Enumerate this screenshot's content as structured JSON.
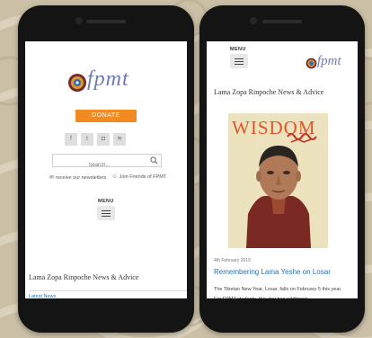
{
  "left_phone": {
    "logo_text": "fpmt",
    "donate_label": "DONATE",
    "social_icons": [
      "facebook-icon",
      "twitter-icon",
      "instagram-icon",
      "rss-icon"
    ],
    "social_glyphs": [
      "f",
      "t",
      "◘",
      "≋"
    ],
    "search_placeholder": "Search...",
    "newsletter_link": "receive our newsletters",
    "friends_link": "Join Friends of FPMT",
    "menu_label": "MENU",
    "section_title": "Lama Zopa Rinpoche News & Advice",
    "latest_news": "Latest News"
  },
  "right_phone": {
    "menu_label": "MENU",
    "logo_text": "fpmt",
    "section_title": "Lama Zopa Rinpoche News & Advice",
    "magazine_title": "WISDOM",
    "date": "4th February 2019",
    "post_title": "Remembering Lama Yeshe on Losar",
    "excerpt": "The Tibetan New Year, Losar, falls on February 5 this year. For FPMT students, this day has additional"
  },
  "colors": {
    "accent_orange": "#f28a22",
    "link_blue": "#2b6fb0",
    "logo_purple": "#6d7ab3",
    "wisdom_orange": "#e0552a"
  }
}
